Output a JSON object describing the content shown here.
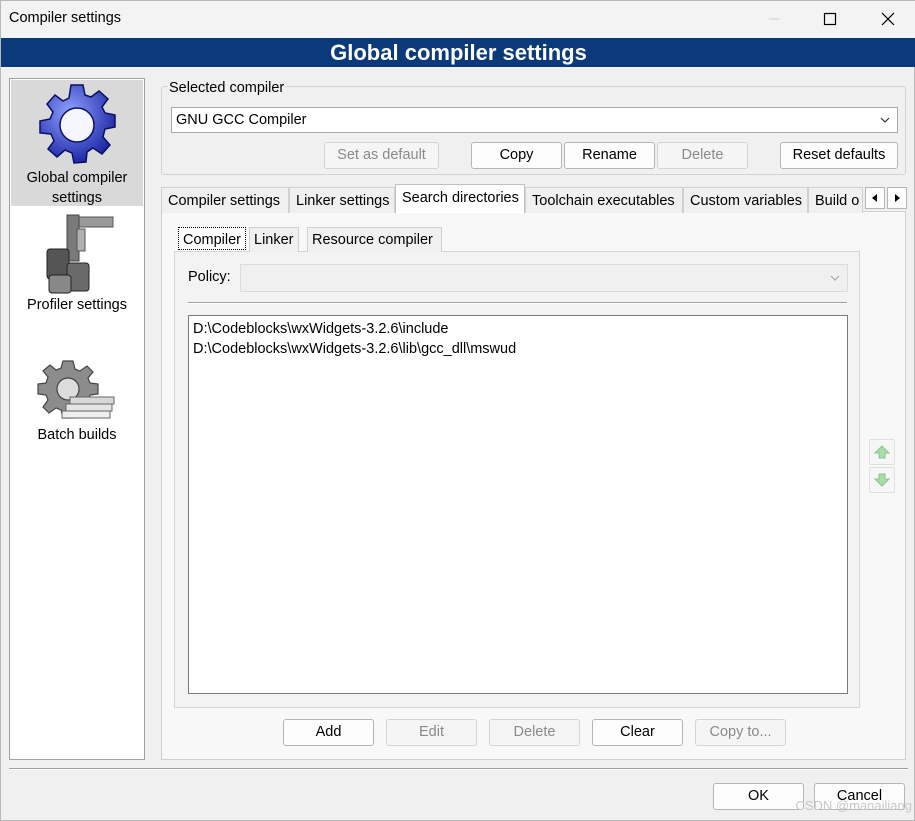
{
  "window": {
    "title": "Compiler settings",
    "banner": "Global compiler settings",
    "controls": [
      "minimize-icon",
      "maximize-icon",
      "close-icon"
    ]
  },
  "sidebar": {
    "items": [
      {
        "label": "Global compiler settings",
        "icon": "gear-icon",
        "selected": true
      },
      {
        "label": "Profiler settings",
        "icon": "caliper-icon",
        "selected": false
      },
      {
        "label": "Batch builds",
        "icon": "gear-stack-icon",
        "selected": false
      }
    ]
  },
  "compiler_group": {
    "label": "Selected compiler",
    "selected_value": "GNU GCC Compiler",
    "buttons": {
      "set_default": "Set as default",
      "copy": "Copy",
      "rename": "Rename",
      "delete": "Delete",
      "reset": "Reset defaults"
    }
  },
  "tabs": [
    {
      "label": "Compiler settings",
      "active": false
    },
    {
      "label": "Linker settings",
      "active": false
    },
    {
      "label": "Search directories",
      "active": true
    },
    {
      "label": "Toolchain executables",
      "active": false
    },
    {
      "label": "Custom variables",
      "active": false
    },
    {
      "label": "Build o",
      "active": false
    }
  ],
  "subtabs": [
    {
      "label": "Compiler",
      "active": true
    },
    {
      "label": "Linker",
      "active": false
    },
    {
      "label": "Resource compiler",
      "active": false
    }
  ],
  "policy": {
    "label": "Policy:",
    "value": ""
  },
  "directories": [
    "D:\\Codeblocks\\wxWidgets-3.2.6\\include",
    "D:\\Codeblocks\\wxWidgets-3.2.6\\lib\\gcc_dll\\mswud"
  ],
  "dir_buttons": {
    "add": "Add",
    "edit": "Edit",
    "delete": "Delete",
    "clear": "Clear",
    "copy_to": "Copy to..."
  },
  "dialog_buttons": {
    "ok": "OK",
    "cancel": "Cancel"
  },
  "watermark": "CSDN @manailiang"
}
